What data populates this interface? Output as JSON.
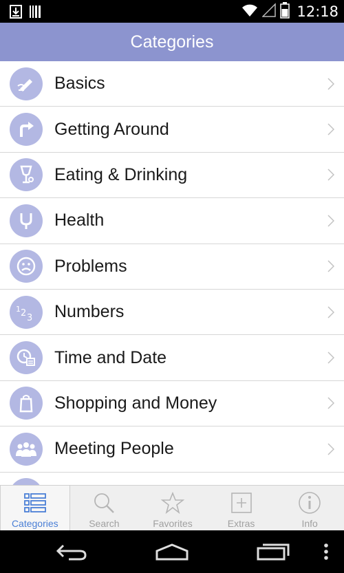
{
  "status_bar": {
    "time": "12:18",
    "icons": [
      "download-icon",
      "barcode-icon",
      "wifi-icon",
      "signal-icon",
      "battery-icon"
    ]
  },
  "header": {
    "title": "Categories",
    "color": "#8c94cf"
  },
  "categories": [
    {
      "label": "Basics",
      "icon": "pencil-icon"
    },
    {
      "label": "Getting Around",
      "icon": "turn-arrow-icon"
    },
    {
      "label": "Eating & Drinking",
      "icon": "glass-icon"
    },
    {
      "label": "Health",
      "icon": "stethoscope-icon"
    },
    {
      "label": "Problems",
      "icon": "sad-face-icon"
    },
    {
      "label": "Numbers",
      "icon": "numbers-icon"
    },
    {
      "label": "Time and Date",
      "icon": "clock-calendar-icon"
    },
    {
      "label": "Shopping and Money",
      "icon": "shopping-bag-icon"
    },
    {
      "label": "Meeting People",
      "icon": "people-icon"
    }
  ],
  "tabs": [
    {
      "label": "Categories",
      "icon": "list-icon",
      "active": true
    },
    {
      "label": "Search",
      "icon": "magnifier-icon",
      "active": false
    },
    {
      "label": "Favorites",
      "icon": "star-icon",
      "active": false
    },
    {
      "label": "Extras",
      "icon": "plus-box-icon",
      "active": false
    },
    {
      "label": "Info",
      "icon": "info-icon",
      "active": false
    }
  ],
  "colors": {
    "icon_circle": "#b3b8e3",
    "active_tab": "#4a7fd6"
  }
}
